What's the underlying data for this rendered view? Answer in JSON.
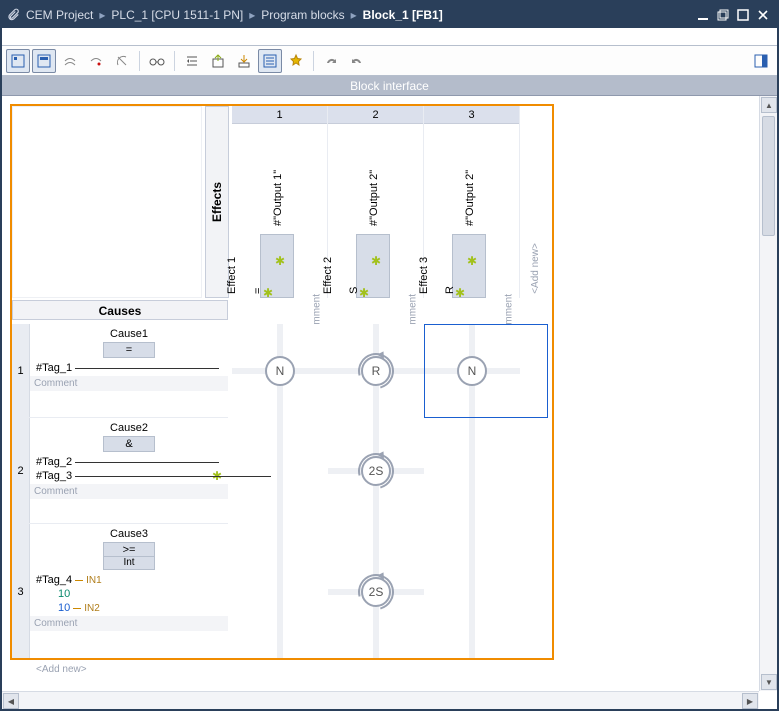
{
  "titlebar": {
    "crumbs": [
      "CEM Project",
      "PLC_1 [CPU 1511-1 PN]",
      "Program blocks",
      "Block_1 [FB1]"
    ]
  },
  "iface": {
    "label": "Block interface"
  },
  "labels": {
    "effects": "Effects",
    "causes": "Causes",
    "add_new": "<Add new>",
    "comment": "Comment",
    "mment": "mment"
  },
  "effects": [
    {
      "num": "1",
      "name": "Effect 1",
      "ins": "=",
      "output": "#\"Output 1\""
    },
    {
      "num": "2",
      "name": "Effect 2",
      "ins": "S",
      "output": "#\"Output 2\""
    },
    {
      "num": "3",
      "name": "Effect 3",
      "ins": "R",
      "output": "#\"Output 2\""
    }
  ],
  "causes": [
    {
      "num": "1",
      "name": "Cause1",
      "op": "=",
      "sub": "",
      "tags": [
        {
          "label": "#Tag_1",
          "pin": ""
        }
      ]
    },
    {
      "num": "2",
      "name": "Cause2",
      "op": "&",
      "sub": "",
      "tags": [
        {
          "label": "#Tag_2",
          "pin": ""
        },
        {
          "label": "#Tag_3",
          "pin": ""
        }
      ]
    },
    {
      "num": "3",
      "name": "Cause3",
      "op": ">=",
      "sub": "Int",
      "tags": [
        {
          "label": "#Tag_4",
          "pin": "IN1"
        },
        {
          "label": "10",
          "pin": "",
          "color": "#0a8a6d"
        },
        {
          "label": "10",
          "pin": "IN2",
          "color": "#1a5fd0"
        }
      ]
    }
  ],
  "nodes": {
    "r1c1": "N",
    "r1c2": "R",
    "r1c3": "N",
    "r2c2": "2S",
    "r3c2": "2S"
  }
}
